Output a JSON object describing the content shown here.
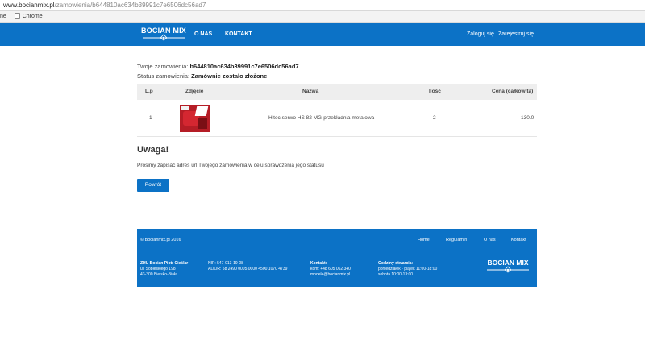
{
  "browser": {
    "url_host": "www.bocianmix.pl",
    "url_path": "/zamowienia/b644810ac634b39991c7e6506dc56ad7",
    "bookmark_apps": "ne",
    "bookmark_chrome": "Chrome"
  },
  "nav": {
    "logo_text": "BOCIAN MIX",
    "about": "O NAS",
    "contact": "KONTAKT",
    "login": "Zaloguj się",
    "register": "Zarejestruj się"
  },
  "order": {
    "id_label": "Twoje zamowienia: ",
    "id_value": "b644810ac634b39991c7e6506dc56ad7",
    "status_label": "Status zamowienia: ",
    "status_value": "Zamównie zostało złożone"
  },
  "table": {
    "headers": {
      "lp": "L.p",
      "photo": "Zdjęcie",
      "name": "Nazwa",
      "qty": "Ilość",
      "price": "Cena (całkowita)"
    },
    "rows": [
      {
        "lp": "1",
        "name": "Hitec serwo HS 82 MG-przekładnia metalowa",
        "qty": "2",
        "price": "130.0"
      }
    ]
  },
  "notice": {
    "title": "Uwaga!",
    "text": "Prosimy zapisać adres url Twojego zamówienia w celu sprawdzenia jego statusu",
    "back_button": "Powrót"
  },
  "footer": {
    "copyright": "© Bocianmix.pl 2016",
    "links": [
      "Home",
      "Regulamin",
      "O nas",
      "Kontakt"
    ],
    "company": {
      "name": "ZHU Bocian Piotr Cieślar",
      "street": "ul. Sobieskiego 198",
      "city": "43-300 Bielsko-Biała"
    },
    "bank": {
      "nip": "NIP: 547-013-19-08",
      "account": "ALIOR: 58 2490 0005 0000 4500 1070 4739"
    },
    "contact": {
      "title": "Kontakt:",
      "phone": "kom: +48 605 062 340",
      "email": "modele@bocianmix.pl"
    },
    "hours": {
      "title": "Godziny otwarcia:",
      "weekdays": "poniedziałek - piątek 11:00-18:00",
      "saturday": "sobota 10:00-13:00"
    },
    "logo_text": "BOCIAN MIX"
  },
  "colors": {
    "brand": "#0c72c6",
    "table_header": "#eeeeee"
  }
}
